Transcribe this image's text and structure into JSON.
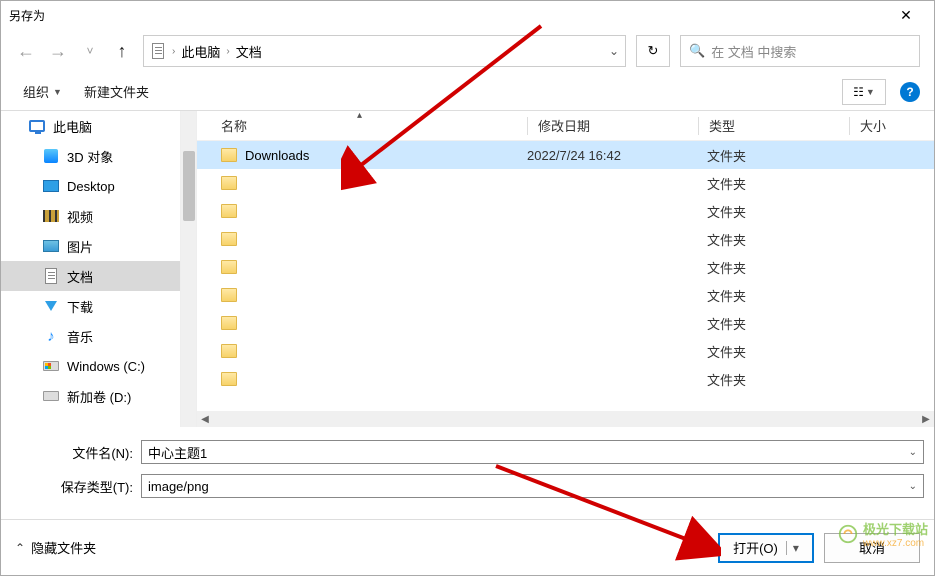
{
  "window": {
    "title": "另存为"
  },
  "breadcrumb": {
    "root": "此电脑",
    "current": "文档"
  },
  "search": {
    "placeholder": "在 文档 中搜索"
  },
  "toolbar": {
    "organize": "组织",
    "newfolder": "新建文件夹"
  },
  "columns": {
    "name": "名称",
    "date": "修改日期",
    "type": "类型",
    "size": "大小"
  },
  "sidebar": [
    {
      "label": "此电脑",
      "icon": "computer",
      "indent": false
    },
    {
      "label": "3D 对象",
      "icon": "blue3d",
      "indent": true
    },
    {
      "label": "Desktop",
      "icon": "desktop",
      "indent": true
    },
    {
      "label": "视频",
      "icon": "video",
      "indent": true
    },
    {
      "label": "图片",
      "icon": "pic",
      "indent": true
    },
    {
      "label": "文档",
      "icon": "doc",
      "indent": true,
      "selected": true
    },
    {
      "label": "下载",
      "icon": "down",
      "indent": true
    },
    {
      "label": "音乐",
      "icon": "music",
      "indent": true
    },
    {
      "label": "Windows (C:)",
      "icon": "drivewin",
      "indent": true
    },
    {
      "label": "新加卷 (D:)",
      "icon": "drive",
      "indent": true
    }
  ],
  "files": [
    {
      "name": "Downloads",
      "date": "2022/7/24 16:42",
      "type": "文件夹",
      "selected": true
    },
    {
      "name": "",
      "date": "",
      "type": "文件夹"
    },
    {
      "name": "",
      "date": "",
      "type": "文件夹"
    },
    {
      "name": "",
      "date": "",
      "type": "文件夹"
    },
    {
      "name": "",
      "date": "",
      "type": "文件夹"
    },
    {
      "name": "",
      "date": "",
      "type": "文件夹"
    },
    {
      "name": "",
      "date": "",
      "type": "文件夹"
    },
    {
      "name": "",
      "date": "",
      "type": "文件夹"
    },
    {
      "name": "",
      "date": "",
      "type": "文件夹"
    }
  ],
  "form": {
    "filename_label": "文件名(N):",
    "filename_value": "中心主题1",
    "filetype_label": "保存类型(T):",
    "filetype_value": "image/png"
  },
  "footer": {
    "hide": "隐藏文件夹",
    "open": "打开(O)",
    "cancel": "取消"
  },
  "watermark": "极光下载站",
  "watermark_url": "www.xz7.com"
}
